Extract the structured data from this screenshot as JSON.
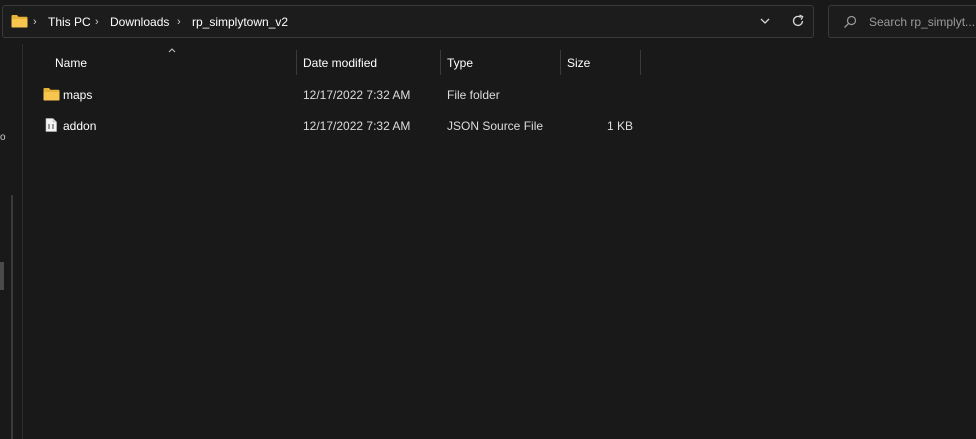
{
  "address_bar": {
    "breadcrumbs": [
      "This PC",
      "Downloads",
      "rp_simplytown_v2"
    ],
    "icon": "folder-icon"
  },
  "search": {
    "placeholder": "Search rp_simplytown_v2",
    "shown": "Search rp_simplyt..."
  },
  "nav_pane": {
    "clipped_text": "o"
  },
  "columns": {
    "name": "Name",
    "date": "Date modified",
    "type": "Type",
    "size": "Size"
  },
  "files": [
    {
      "name": "maps",
      "date": "12/17/2022 7:32 AM",
      "type": "File folder",
      "size": "",
      "icon": "folder-icon"
    },
    {
      "name": "addon",
      "date": "12/17/2022 7:32 AM",
      "type": "JSON Source File",
      "size": "1 KB",
      "icon": "json-file-icon"
    }
  ],
  "colors": {
    "background": "#191919",
    "folder": "#f2c24b",
    "border": "#3a3a3a"
  }
}
